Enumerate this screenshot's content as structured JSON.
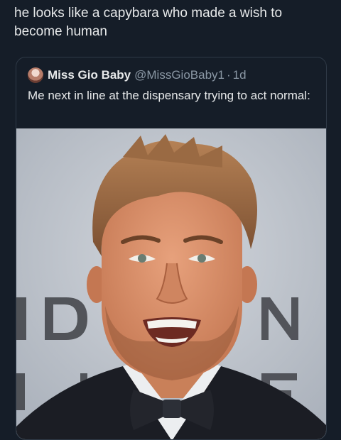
{
  "post": {
    "text": "he looks like a capybara who made a wish to become human"
  },
  "quoted_post": {
    "author_name": "Miss Gio Baby",
    "handle": "@MissGioBaby1",
    "separator": "·",
    "time": "1d",
    "text": "Me next in line at the dispensary trying to act normal:"
  },
  "media": {
    "description_icon": "photo-of-smiling-man-in-tuxedo"
  },
  "colors": {
    "background": "#151d28",
    "text": "#e7e9ea",
    "muted": "#8b98a5",
    "border": "#2f3a47"
  }
}
